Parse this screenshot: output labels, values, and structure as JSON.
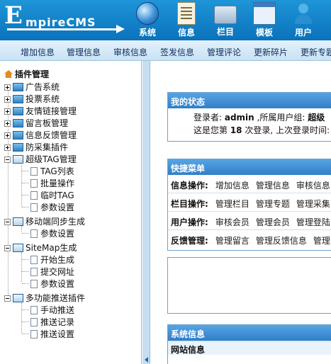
{
  "logo": {
    "first": "E",
    "rest": "mpireCMS"
  },
  "topnav": [
    {
      "label": "系统",
      "icon": "globe-icon"
    },
    {
      "label": "信息",
      "icon": "document-icon"
    },
    {
      "label": "栏目",
      "icon": "folder-icon"
    },
    {
      "label": "模板",
      "icon": "window-icon"
    },
    {
      "label": "用户",
      "icon": "user-icon"
    }
  ],
  "subnav": [
    "增加信息",
    "管理信息",
    "审核信息",
    "签发信息",
    "管理评论",
    "更新碎片",
    "更新专题"
  ],
  "sidebar": {
    "title": "插件管理",
    "nodes": [
      {
        "label": "广告系统"
      },
      {
        "label": "投票系统"
      },
      {
        "label": "友情链接管理"
      },
      {
        "label": "留言板管理"
      },
      {
        "label": "信息反馈管理"
      },
      {
        "label": "防采集插件"
      },
      {
        "label": "超级TAG管理",
        "children": [
          "TAG列表",
          "批量操作",
          "临时TAG",
          "参数设置"
        ]
      },
      {
        "label": "移动端同步生成",
        "children": [
          "参数设置"
        ]
      },
      {
        "label": "SiteMap生成",
        "children": [
          "开始生成",
          "提交网址",
          "参数设置"
        ]
      },
      {
        "label": "多功能推送插件",
        "children": [
          "手动推送",
          "推送记录",
          "推送设置"
        ]
      }
    ]
  },
  "status": {
    "title": "我的状态",
    "line1_a": "登录者: ",
    "user": "admin",
    "line1_b": "  ,所属用户组: ",
    "group": "超级",
    "line2_a": "这是您第 ",
    "count": "18",
    "line2_b": " 次登录, 上次登录时间:"
  },
  "quick": {
    "title": "快捷菜单",
    "rows": [
      {
        "label": "信息操作:",
        "links": [
          "增加信息",
          "管理信息",
          "审核信息"
        ]
      },
      {
        "label": "栏目操作:",
        "links": [
          "管理栏目",
          "管理专题",
          "管理采集"
        ]
      },
      {
        "label": "用户操作:",
        "links": [
          "审核会员",
          "管理会员",
          "管理登陆"
        ]
      },
      {
        "label": "反馈管理:",
        "links": [
          "管理留言",
          "管理反馈信息",
          "管理"
        ]
      }
    ]
  },
  "system": {
    "title": "系统信息",
    "sub": "网站信息"
  }
}
